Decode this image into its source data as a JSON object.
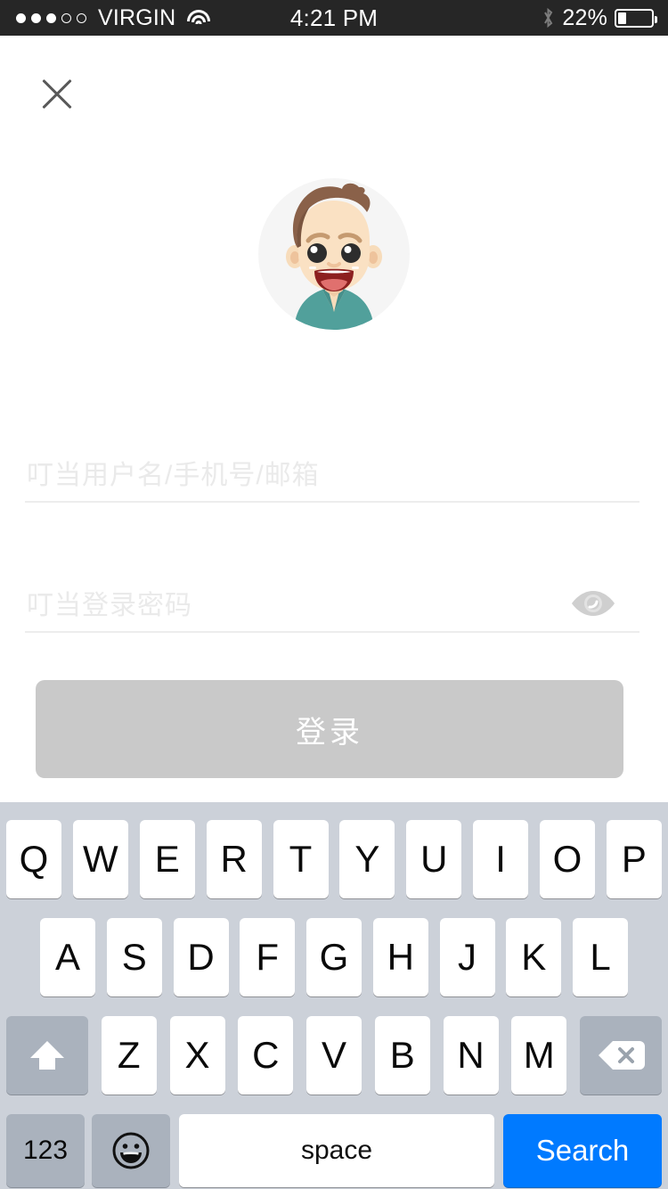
{
  "status_bar": {
    "signal_dots": [
      true,
      true,
      true,
      false,
      false
    ],
    "carrier": "VIRGIN",
    "wifi_icon": "wifi-icon",
    "time": "4:21 PM",
    "bluetooth_icon": "bluetooth-icon",
    "battery_percent": "22%",
    "battery_level": 22
  },
  "nav": {
    "close_icon": "close-icon"
  },
  "avatar": {
    "name": "user-avatar",
    "hair_color": "#8a6149",
    "skin_color": "#fadcbb",
    "shirt_color": "#51a09b",
    "background_color": "#f5f5f5"
  },
  "form": {
    "username": {
      "placeholder": "叮当用户名/手机号/邮箱",
      "value": ""
    },
    "password": {
      "placeholder": "叮当登录密码",
      "value": "",
      "toggle_icon": "eye-icon"
    },
    "submit_label": "登录",
    "submit_color": "#c9c9c9",
    "submit_text_color": "#ffffff"
  },
  "keyboard": {
    "background_color": "#ccd1d9",
    "row1": [
      "Q",
      "W",
      "E",
      "R",
      "T",
      "Y",
      "U",
      "I",
      "O",
      "P"
    ],
    "row2": [
      "A",
      "S",
      "D",
      "F",
      "G",
      "H",
      "J",
      "K",
      "L"
    ],
    "row3": [
      "Z",
      "X",
      "C",
      "V",
      "B",
      "N",
      "M"
    ],
    "shift_icon": "shift-arrow-icon",
    "backspace_icon": "backspace-icon",
    "numbers_label": "123",
    "emoji_icon": "smiley-face-icon",
    "space_label": "space",
    "return_label": "Search",
    "return_color": "#007aff"
  }
}
